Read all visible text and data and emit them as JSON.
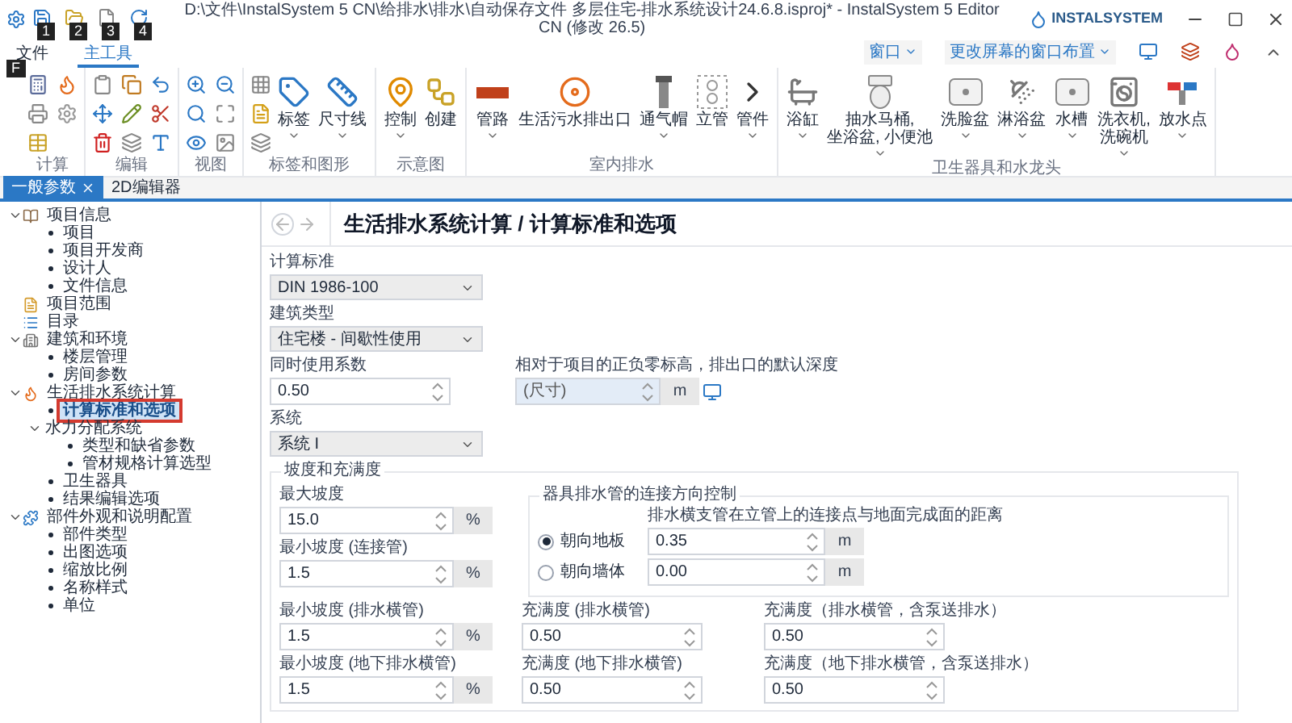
{
  "title_bar": {
    "title": "D:\\文件\\InstalSystem 5 CN\\给排水\\排水\\自动保存文件 多层住宅-排水系统设计24.6.8.isproj* - InstalSystem 5 Editor CN (修改 26.5)",
    "quick_access_keytips": [
      "1",
      "2",
      "3",
      "4"
    ],
    "logo": "INSTALSYSTEM"
  },
  "ribbon_tabs": [
    {
      "label": "文件",
      "keytip": "F",
      "selected": false
    },
    {
      "label": "主工具",
      "selected": true
    }
  ],
  "window_menu": "窗口",
  "layout_menu": "更改屏幕的窗口布置",
  "ribbon_groups": [
    {
      "label": "计算"
    },
    {
      "label": "编辑"
    },
    {
      "label": "视图"
    },
    {
      "label": "标签和图形",
      "buttons": [
        {
          "label": "标签",
          "menu": true
        },
        {
          "label": "尺寸线",
          "menu": true
        }
      ]
    },
    {
      "label": "示意图",
      "buttons": [
        {
          "label": "控制",
          "menu": true
        },
        {
          "label": "创建",
          "menu": false
        }
      ]
    },
    {
      "label": "室内排水",
      "buttons": [
        {
          "label": "管路",
          "menu": true
        },
        {
          "label": "生活污水排出口",
          "menu": false
        },
        {
          "label": "通气帽",
          "menu": true
        },
        {
          "label": "立管",
          "menu": false
        },
        {
          "label": "管件",
          "menu": true
        }
      ]
    },
    {
      "label": "卫生器具和水龙头",
      "buttons": [
        {
          "label": "浴缸",
          "menu": true
        },
        {
          "label": "抽水马桶,\n坐浴盆, 小便池",
          "menu": true
        },
        {
          "label": "洗脸盆",
          "menu": true
        },
        {
          "label": "淋浴盆",
          "menu": true
        },
        {
          "label": "水槽",
          "menu": true
        },
        {
          "label": "洗衣机,\n洗碗机",
          "menu": true
        },
        {
          "label": "放水点",
          "menu": true
        }
      ]
    }
  ],
  "document_tabs": [
    {
      "label": "一般参数",
      "selected": true,
      "closable": true
    },
    {
      "label": "2D编辑器",
      "selected": false,
      "closable": false
    }
  ],
  "tree": [
    {
      "label": "项目信息",
      "kind": "info",
      "expanded": true,
      "selected": false,
      "children": [
        {
          "label": "项目",
          "kind": "bullet",
          "selected": false
        },
        {
          "label": "项目开发商",
          "kind": "bullet",
          "selected": false
        },
        {
          "label": "设计人",
          "kind": "bullet",
          "selected": false
        },
        {
          "label": "文件信息",
          "kind": "bullet",
          "selected": false
        }
      ]
    },
    {
      "label": "项目范围",
      "kind": "scope",
      "selected": false
    },
    {
      "label": "目录",
      "kind": "catalog",
      "selected": false
    },
    {
      "label": "建筑和环境",
      "kind": "building",
      "expanded": true,
      "selected": false,
      "children": [
        {
          "label": "楼层管理",
          "kind": "bullet",
          "selected": false
        },
        {
          "label": "房间参数",
          "kind": "bullet",
          "selected": false
        }
      ]
    },
    {
      "label": "生活排水系统计算",
      "kind": "drainage",
      "expanded": true,
      "selected": false,
      "children": [
        {
          "label": "计算标准和选项",
          "kind": "bullet",
          "selected": true
        },
        {
          "label": "水力分配系统",
          "kind": "plain",
          "expanded": true,
          "selected": false,
          "children": [
            {
              "label": "类型和缺省参数",
              "kind": "bullet",
              "selected": false
            },
            {
              "label": "管材规格计算选型",
              "kind": "bullet",
              "selected": false
            }
          ]
        },
        {
          "label": "卫生器具",
          "kind": "bullet",
          "selected": false
        },
        {
          "label": "结果编辑选项",
          "kind": "bullet",
          "selected": false
        }
      ]
    },
    {
      "label": "部件外观和说明配置",
      "kind": "parts",
      "expanded": true,
      "selected": false,
      "children": [
        {
          "label": "部件类型",
          "kind": "bullet",
          "selected": false
        },
        {
          "label": "出图选项",
          "kind": "bullet",
          "selected": false
        },
        {
          "label": "缩放比例",
          "kind": "bullet",
          "selected": false
        },
        {
          "label": "名称样式",
          "kind": "bullet",
          "selected": false
        },
        {
          "label": "单位",
          "kind": "bullet",
          "selected": false
        }
      ]
    }
  ],
  "page": {
    "title": "生活排水系统计算 / 计算标准和选项",
    "fields": [
      {
        "kind": "select",
        "label": "计算标准",
        "value": "DIN 1986-100"
      },
      {
        "kind": "select",
        "label": "建筑类型",
        "value": "住宅楼 - 间歇性使用"
      },
      {
        "kind": "pair",
        "label": "同时使用系数",
        "value": "0.50",
        "label_2": "相对于项目的正负零标高，排出口的默认深度",
        "placeholder_2": "(尺寸)",
        "unit_2": "m"
      },
      {
        "kind": "select",
        "label": "系统",
        "value": "系统 I"
      }
    ],
    "slope_group": {
      "title": "坡度和充满度",
      "max_slope": {
        "label": "最大坡度",
        "value": "15.0",
        "unit": "%"
      },
      "min_slope_connection": {
        "label": "最小坡度 (连接管)",
        "value": "1.5",
        "unit": "%"
      },
      "direction": {
        "title": "器具排水管的连接方向控制",
        "distance_label": "排水横支管在立管上的连接点与地面完成面的距离",
        "options": [
          {
            "label": "朝向地板",
            "selected": true,
            "value": "0.35",
            "unit": "m"
          },
          {
            "label": "朝向墙体",
            "selected": false,
            "value": "0.00",
            "unit": "m"
          }
        ]
      },
      "rows": [
        [
          {
            "label": "最小坡度 (排水横管)",
            "value": "1.5",
            "unit": "%"
          },
          {
            "label": "充满度 (排水横管)",
            "value": "0.50"
          },
          {
            "label": "充满度（排水横管，含泵送排水）",
            "value": "0.50"
          }
        ],
        [
          {
            "label": "最小坡度 (地下排水横管)",
            "value": "1.5",
            "unit": "%"
          },
          {
            "label": "充满度 (地下排水横管)",
            "value": "0.50"
          },
          {
            "label": "充满度（地下排水横管，含泵送排水）",
            "value": "0.50"
          }
        ]
      ]
    }
  }
}
